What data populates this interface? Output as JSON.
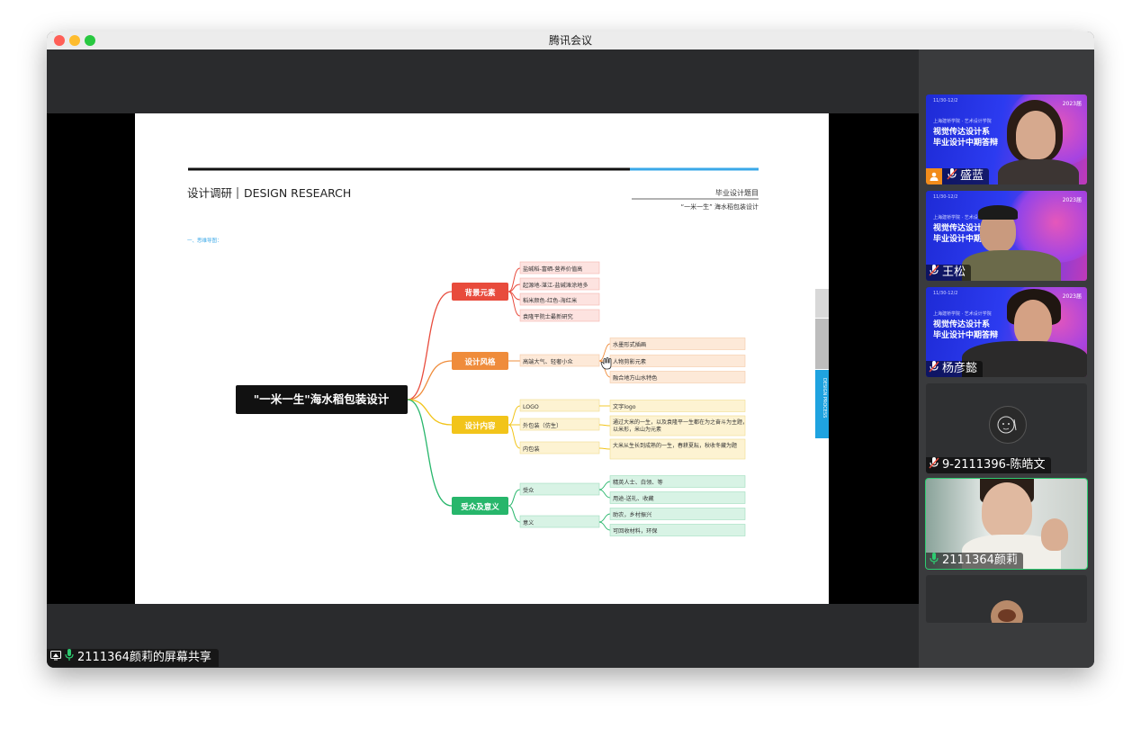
{
  "window": {
    "title": "腾讯会议"
  },
  "share": {
    "label": "2111364颜莉的屏幕共享"
  },
  "slide": {
    "heading_cn": "设计调研",
    "heading_en": "DESIGN RESEARCH",
    "topic_label": "毕业设计题目",
    "topic": "“一米一生” 海水稻包装设计",
    "section_label": "一、思维导图：",
    "side_tabs": [
      "",
      "",
      ""
    ],
    "side_tab_blue": "DESIGN PROCESS"
  },
  "mindmap": {
    "root": "\"一米一生\"海水稻包装设计",
    "branches": [
      {
        "label": "背景元素",
        "color": "#e84b3c",
        "children": [
          "盐碱稻-富硒-营养价值高",
          "起源地-湛江-盐碱滩涂地多",
          "稻米颜色-红色-海红米",
          "袁隆平院士最新研究"
        ]
      },
      {
        "label": "设计风格",
        "color": "#ef8c3b",
        "children": [
          "高端大气、轻奢小众"
        ],
        "sub": [
          "水墨形式插画",
          "人物剪影元素",
          "融合地方山水特色"
        ]
      },
      {
        "label": "设计内容",
        "color": "#f2c41a",
        "children": [
          "LOGO",
          "外包装（仿生）",
          "内包装"
        ],
        "sub": [
          "文字logo",
          "通过大米的一生，以及袁隆平一生都在为之奋斗为主题，以米形，米山为元素",
          "大米从生长到成熟的一生，春耕夏耘，秋收冬藏为题"
        ]
      },
      {
        "label": "受众及意义",
        "color": "#27b66b",
        "children": [
          "受众",
          "意义"
        ],
        "sub": [
          "精英人士、白领、等",
          "用途-送礼、收藏",
          "助农，乡村振兴",
          "可回收材料，环保"
        ]
      }
    ]
  },
  "participants": [
    {
      "name": "盛蓝",
      "host": true,
      "mic": "muted",
      "banner": [
        "视觉传达设计系",
        "毕业设计中期答辩"
      ],
      "banner_small": "上海建桥学院 · 艺术设计学院",
      "date": "11/30-12/2",
      "year": "2023届"
    },
    {
      "name": "王松",
      "host": false,
      "mic": "muted",
      "banner": [
        "视觉传达设计",
        "毕业设计中期"
      ],
      "banner_small": "上海建桥学院 · 艺术设计学院",
      "date": "11/30-12/2",
      "year": "2023届"
    },
    {
      "name": "杨彦懿",
      "host": false,
      "mic": "muted",
      "banner": [
        "视觉传达设计系",
        "毕业设计中期答辩"
      ],
      "banner_small": "上海建桥学院 · 艺术设计学院",
      "date": "11/30-12/2",
      "year": "2023届"
    },
    {
      "name": "9-2111396-陈皓文",
      "host": false,
      "mic": "muted"
    },
    {
      "name": "2111364颜莉",
      "host": false,
      "mic": "active"
    },
    {
      "name": "",
      "host": false,
      "mic": "none"
    }
  ],
  "colors": {
    "accent_green": "#2ecc71",
    "host_orange": "#f28c1b",
    "slide_blue": "#1fa3e0"
  }
}
